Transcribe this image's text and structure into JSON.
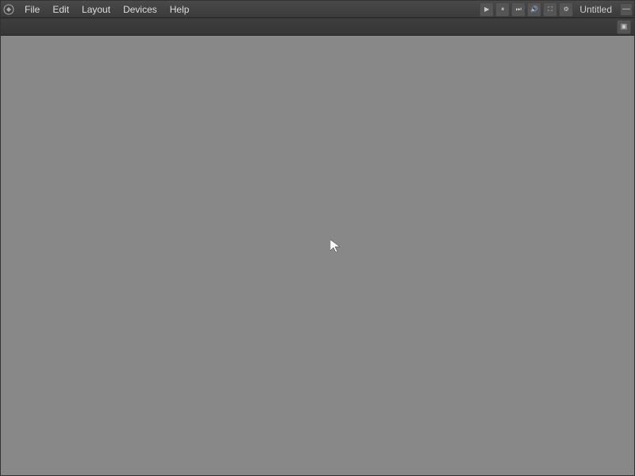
{
  "menubar": {
    "items": [
      {
        "id": "file",
        "label": "File"
      },
      {
        "id": "edit",
        "label": "Edit"
      },
      {
        "id": "layout",
        "label": "Layout"
      },
      {
        "id": "devices",
        "label": "Devices"
      },
      {
        "id": "help",
        "label": "Help"
      }
    ]
  },
  "transport": {
    "play_label": "▶",
    "pause_label": "⏸",
    "skip_end_label": "⏭",
    "volume_label": "🔊",
    "fullscreen_label": "⛶",
    "settings_label": "⚙"
  },
  "titlebar": {
    "title": "Untitled",
    "close_label": "—"
  },
  "toolbar": {
    "panel_icon_label": "▣"
  },
  "canvas": {
    "background_color": "#888888"
  }
}
